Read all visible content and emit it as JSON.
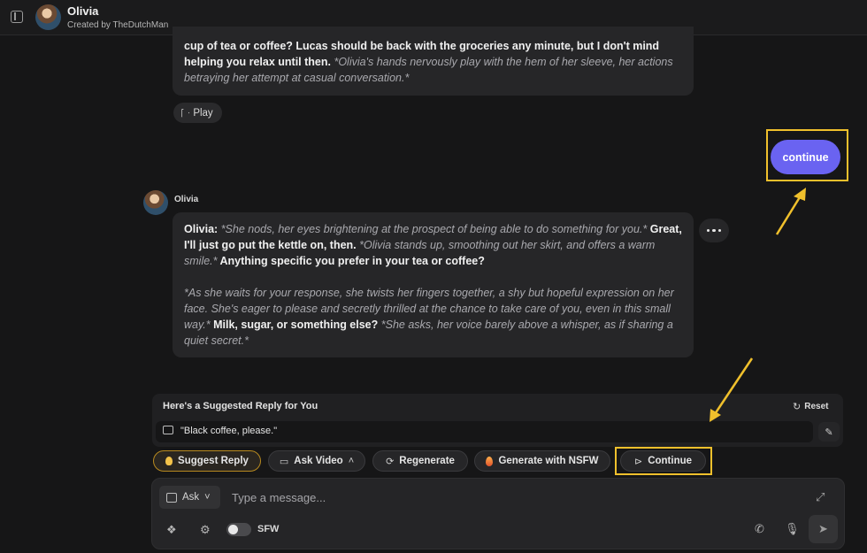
{
  "header": {
    "name": "Olivia",
    "creator": "Created by TheDutchMan"
  },
  "messages": {
    "first": {
      "text_bold": "cup of tea or coffee? Lucas should be back with the groceries any minute, but I don't mind helping you relax until then.",
      "text_action": " *Olivia's hands nervously play with the hem of her sleeve, her actions betraying her attempt at casual conversation.*",
      "play_label": "Play"
    },
    "second": {
      "sender": "Olivia",
      "p1_lead": "Olivia:",
      "p1_act1": " *She nods, her eyes brightening at the prospect of being able to do something for you.*",
      "p1_text1": " Great, I'll just go put the kettle on, then.",
      "p1_act2": " *Olivia stands up, smoothing out her skirt, and offers a warm smile.*",
      "p1_text2": " Anything specific you prefer in your tea or coffee?",
      "p2_act1": "*As she waits for your response, she twists her fingers together, a shy but hopeful expression on her face. She's eager to please and secretly thrilled at the chance to take care of you, even in this small way.*",
      "p2_text1": " Milk, sugar, or something else?",
      "p2_act2": " *She asks, her voice barely above a whisper, as if sharing a quiet secret.*"
    }
  },
  "continue_highlight_label": "continue",
  "suggestion": {
    "title": "Here's a Suggested Reply for You",
    "reset_label": "Reset",
    "text": "\"Black coffee, please.\""
  },
  "actions": {
    "suggest_reply": "Suggest Reply",
    "ask_video": "Ask Video",
    "regenerate": "Regenerate",
    "generate_nsfw": "Generate with NSFW",
    "continue": "Continue"
  },
  "composer": {
    "mode": "Ask",
    "placeholder": "Type a message...",
    "sfw_label": "SFW"
  },
  "colors": {
    "accent": "#6a63f1",
    "highlight": "#f0c02c",
    "background": "#161617"
  },
  "icons": [
    "sidebar-toggle-icon",
    "chat-icon",
    "pencil-icon",
    "reset-icon",
    "bulb-icon",
    "video-icon",
    "regenerate-icon",
    "flame-icon",
    "continue-icon",
    "image-icon",
    "expand-icon",
    "persona-icon",
    "settings-icon",
    "phone-icon",
    "mic-icon",
    "send-icon",
    "more-icon",
    "play-icon"
  ]
}
